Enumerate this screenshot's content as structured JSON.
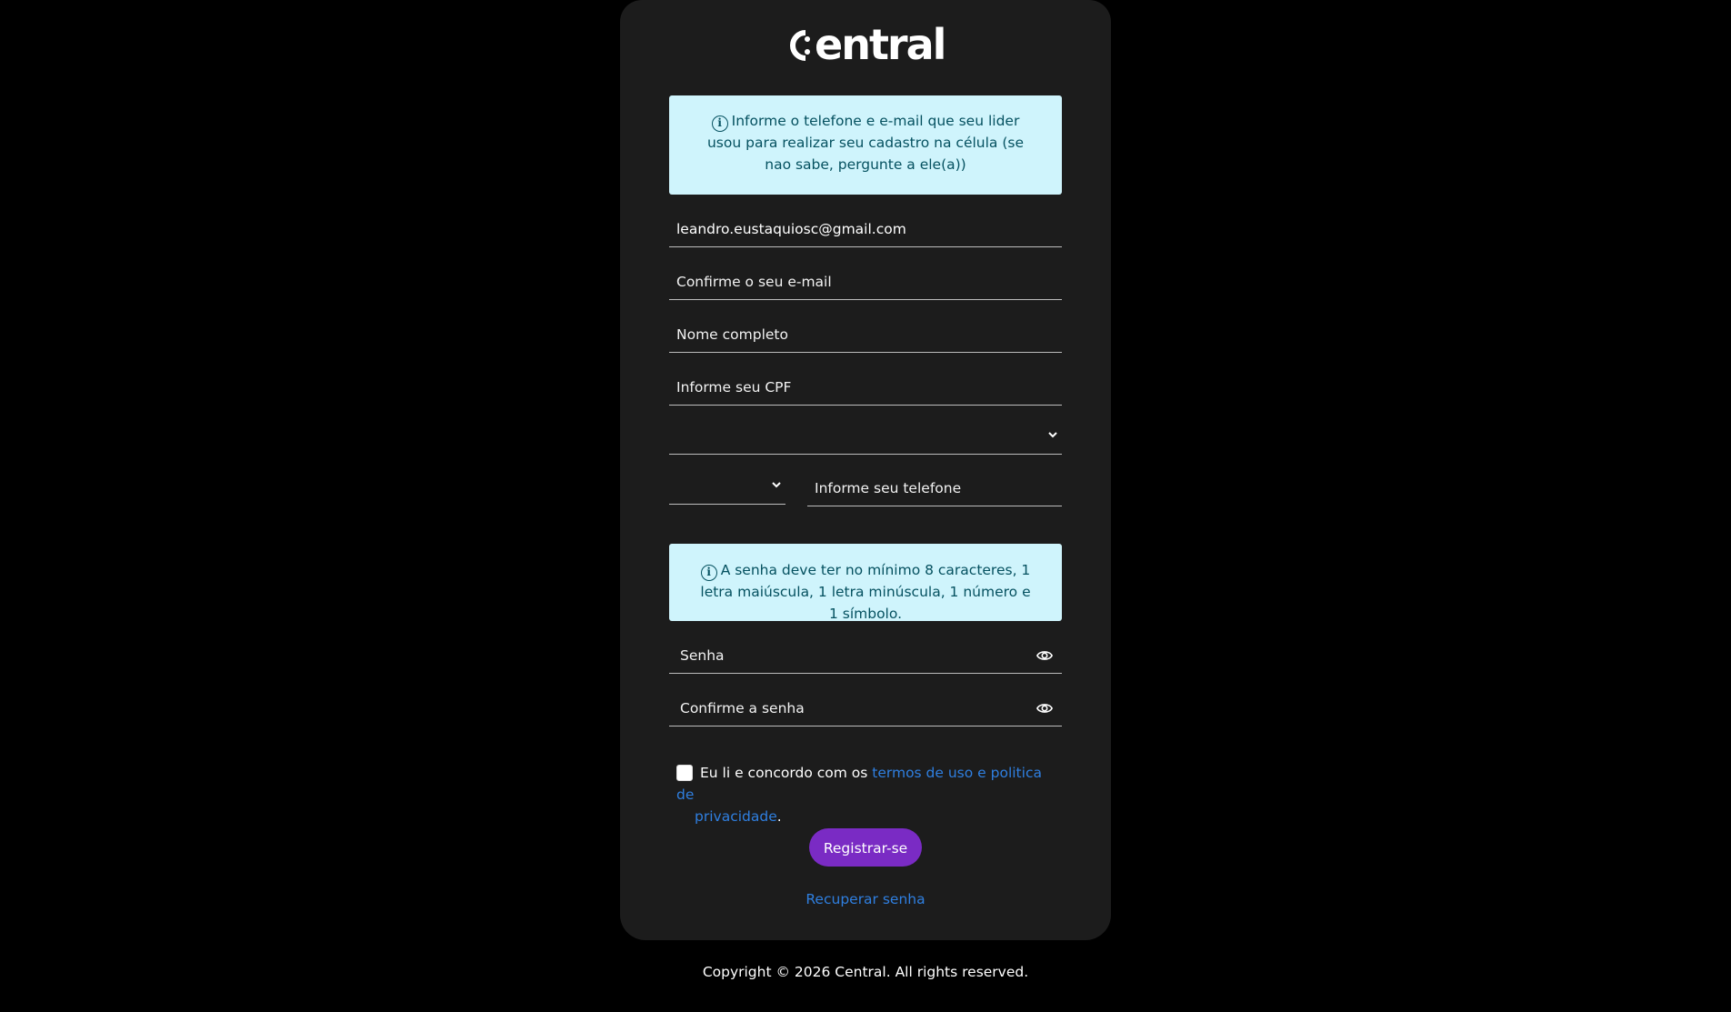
{
  "brand": {
    "logo_text": "central"
  },
  "notices": {
    "contact_info": "Informe o telefone e e-mail que seu lider usou para realizar seu cadastro na célula (se nao sabe, pergunte a ele(a))",
    "password_rules": "A senha deve ter no mínimo 8 caracteres, 1 letra maiúscula, 1 letra minúscula, 1 número e 1 símbolo."
  },
  "form": {
    "email_value": "leandro.eustaquiosc@gmail.com",
    "email_confirm_placeholder": "Confirme o seu e-mail",
    "full_name_placeholder": "Nome completo",
    "cpf_placeholder": "Informe seu CPF",
    "select_value": "",
    "ddi_value": "",
    "phone_placeholder": "Informe seu telefone",
    "password_placeholder": "Senha",
    "password_confirm_placeholder": "Confirme a senha",
    "terms_checked": false,
    "terms_prefix": "Eu li e concordo com os ",
    "terms_link_part1": "termos de uso e politica de",
    "terms_link_part2": "privacidade",
    "terms_suffix": ".",
    "submit_label": "Registrar-se",
    "recover_label": "Recuperar senha"
  },
  "footer": {
    "copyright": "Copyright © 2026 Central. All rights reserved."
  },
  "colors": {
    "page_bg": "#000000",
    "card_bg": "#1c1c1c",
    "info_bg": "#cff4fc",
    "info_text": "#055160",
    "primary_button": "#7a2bc4",
    "link": "#2f7fe0"
  },
  "icons": {
    "info": "info-circle-icon",
    "eye": "eye-icon",
    "chevron": "chevron-down-icon"
  }
}
